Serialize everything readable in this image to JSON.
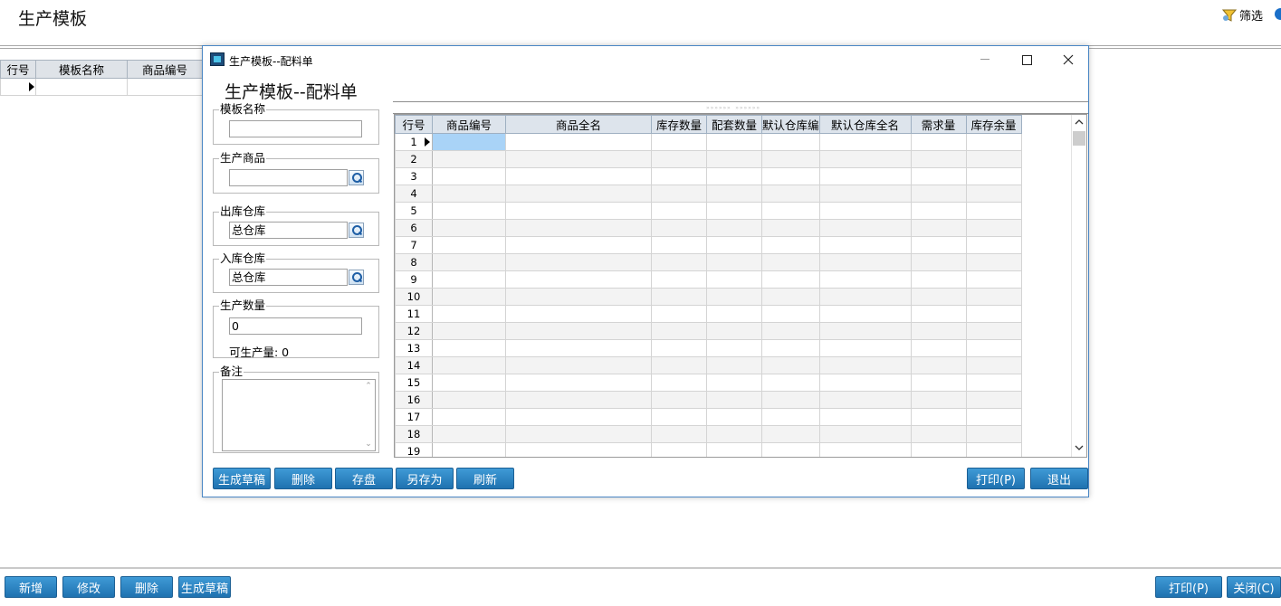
{
  "main": {
    "title": "生产模板",
    "filter_label": "筛选",
    "grid_headers": [
      "行号",
      "模板名称",
      "商品编号"
    ],
    "buttons": {
      "add": "新增",
      "edit": "修改",
      "delete": "删除",
      "draft": "生成草稿",
      "print": "打印(P)",
      "close": "关闭(C)"
    }
  },
  "dialog": {
    "window_title": "生产模板--配料单",
    "heading": "生产模板--配料单",
    "fields": {
      "template_name": {
        "label": "模板名称",
        "value": ""
      },
      "product": {
        "label": "生产商品",
        "value": ""
      },
      "out_warehouse": {
        "label": "出库仓库",
        "value": "总仓库"
      },
      "in_warehouse": {
        "label": "入库仓库",
        "value": "总仓库"
      },
      "quantity": {
        "label": "生产数量",
        "value": "0"
      },
      "capacity": "可生产量: 0",
      "notes": {
        "label": "备注",
        "value": ""
      }
    },
    "grid": {
      "headers": [
        "行号",
        "商品编号",
        "商品全名",
        "库存数量",
        "配套数量",
        "默认仓库编",
        "默认仓库全名",
        "需求量",
        "库存余量"
      ],
      "row_numbers": [
        "1",
        "2",
        "3",
        "4",
        "5",
        "6",
        "7",
        "8",
        "9",
        "10",
        "11",
        "12",
        "13",
        "14",
        "15",
        "16",
        "17",
        "18",
        "19"
      ]
    },
    "buttons": {
      "draft": "生成草稿",
      "delete": "删除",
      "save": "存盘",
      "save_as": "另存为",
      "refresh": "刷新",
      "print": "打印(P)",
      "exit": "退出"
    }
  }
}
